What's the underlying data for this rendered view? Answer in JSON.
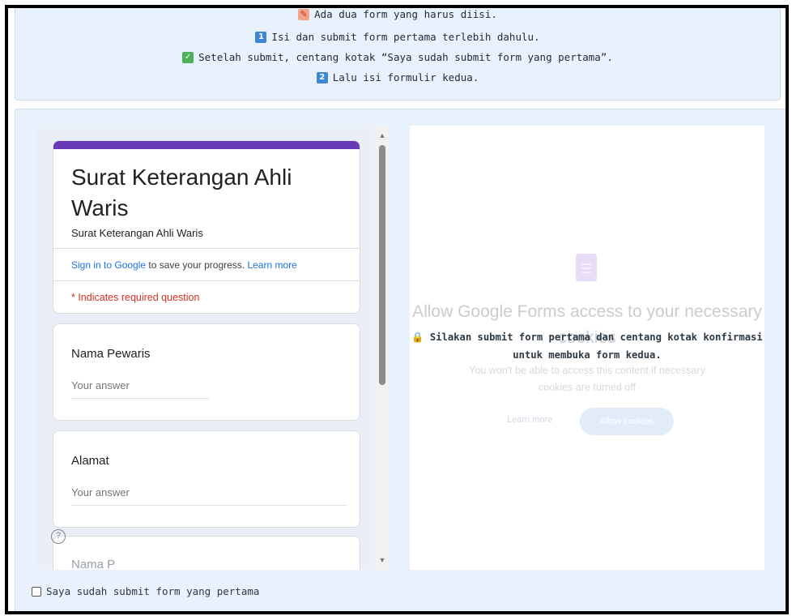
{
  "instructions": {
    "line1": {
      "icon": "memo-icon",
      "text": "Ada dua form yang harus diisi."
    },
    "line2": {
      "icon": "keycap-1-icon",
      "badge": "1",
      "text": "Isi dan submit form pertama terlebih dahulu."
    },
    "line3": {
      "icon": "check-mark-button-icon",
      "badge": "✓",
      "text": "Setelah submit, centang kotak “Saya sudah submit form yang pertama”."
    },
    "line4": {
      "icon": "keycap-2-icon",
      "badge": "2",
      "text": "Lalu isi formulir kedua."
    }
  },
  "form": {
    "title": "Surat Keterangan Ahli Waris",
    "description": "Surat Keterangan Ahli Waris",
    "signin_link": "Sign in to Google",
    "signin_text": " to save your progress. ",
    "learn_more": "Learn more",
    "required_note": "* Indicates required question",
    "questions": [
      {
        "label": "Nama Pewaris",
        "placeholder": "Your answer"
      },
      {
        "label": "Alamat",
        "placeholder": "Your answer"
      },
      {
        "label": "Nama P",
        "placeholder": ""
      }
    ],
    "help_icon": "question-circle-icon"
  },
  "second_form": {
    "faded_title": "Allow Google Forms access to your necessary cookies",
    "faded_subtitle": "You won't be able to access this content if necessary cookies are turned off",
    "faded_learn_more": "Learn more",
    "faded_allow": "Allow cookies",
    "lock_icon": "lock-icon",
    "lock_line1": "Silakan submit form pertama dan centang kotak konfirmasi",
    "lock_line2": "untuk membuka form kedua."
  },
  "confirm": {
    "label": "Saya sudah submit form yang pertama",
    "checked": false
  },
  "colors": {
    "panel_bg": "#e8f1fc",
    "form_accent": "#673ab7",
    "link": "#1a73e8",
    "required": "#d93025"
  }
}
